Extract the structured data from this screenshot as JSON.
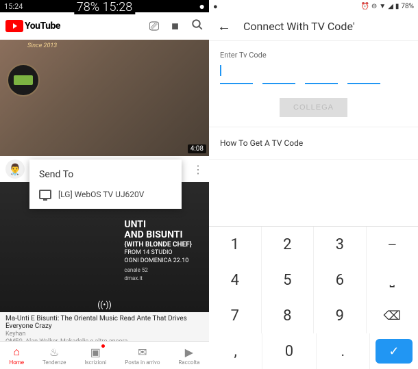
{
  "center_time": "78% 15:28",
  "left": {
    "status": {
      "time": "15:24",
      "msg_icon": "●"
    },
    "yt_logo_text": "YouTube",
    "since": "Since 2013",
    "video1": {
      "duration": "4:08",
      "title": "..."
    },
    "dialog": {
      "title": "Send To",
      "device": "[LG] WebOS TV UJ620V"
    },
    "video2": {
      "line1": "UNTI",
      "line2": "AND BISUNTI",
      "line3": "{WITH BLONDE CHEF}",
      "line4": "FROM 14 STUDIO",
      "line5": "OGNI DOMENICA 22.10",
      "channel": "canale 52",
      "site": "dmax.it"
    },
    "video2_info": {
      "title": "Ma-Unti E Bisunti: The Oriental Music Read Ante That Drives Everyone Crazy",
      "meta1": "Keyhan",
      "meta2": "OMFG, Alan Walker, Makadelic e altro ancora"
    },
    "nav": {
      "home": "Home",
      "trending": "Tendenze",
      "subs": "Iscrizioni",
      "inbox": "Posta in arrivo",
      "library": "Raccolta"
    }
  },
  "right": {
    "status": {
      "msg_icon": "●",
      "battery": "78%"
    },
    "title": "Connect With TV Code'",
    "enter_label": "Enter Tv Code",
    "button": "COLLEGA",
    "howto": "How To Get A TV Code",
    "keys": {
      "1": "1",
      "2": "2",
      "3": "3",
      "dash": "—",
      "4": "4",
      "5": "5",
      "6": "6",
      "space": "⎵",
      "7": "7",
      "8": "8",
      "9": "9",
      "back": "⌫",
      "comma": ",",
      "0": "0",
      "dot": ".",
      "done": "✓"
    }
  }
}
